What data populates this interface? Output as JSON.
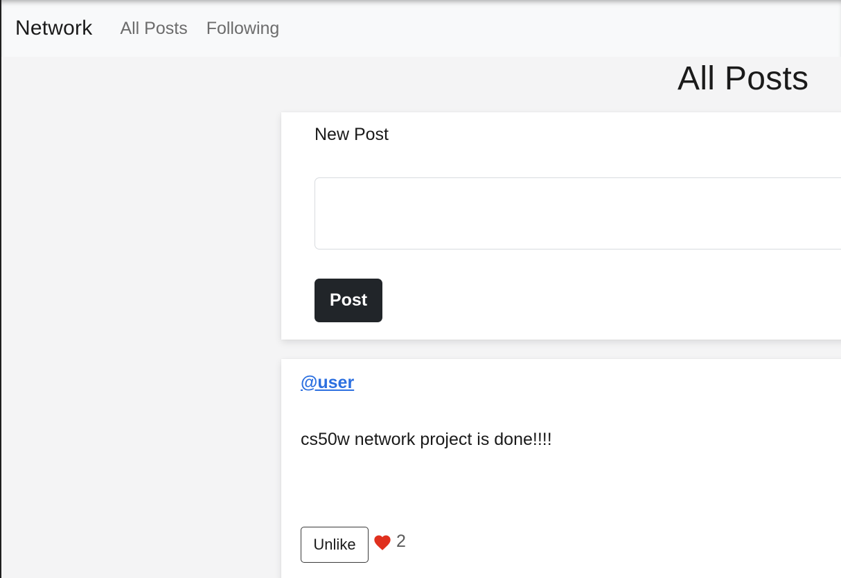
{
  "navbar": {
    "brand": "Network",
    "links": [
      {
        "label": "All Posts"
      },
      {
        "label": "Following"
      }
    ]
  },
  "page": {
    "title": "All Posts"
  },
  "new_post": {
    "label": "New Post",
    "textarea_value": "",
    "button_label": "Post"
  },
  "posts": [
    {
      "username": "@user",
      "content": "cs50w network project is done!!!!",
      "like_button_label": "Unlike",
      "like_count": "2",
      "heart_icon": "heart-icon",
      "heart_color": "#e0301e"
    }
  ]
}
